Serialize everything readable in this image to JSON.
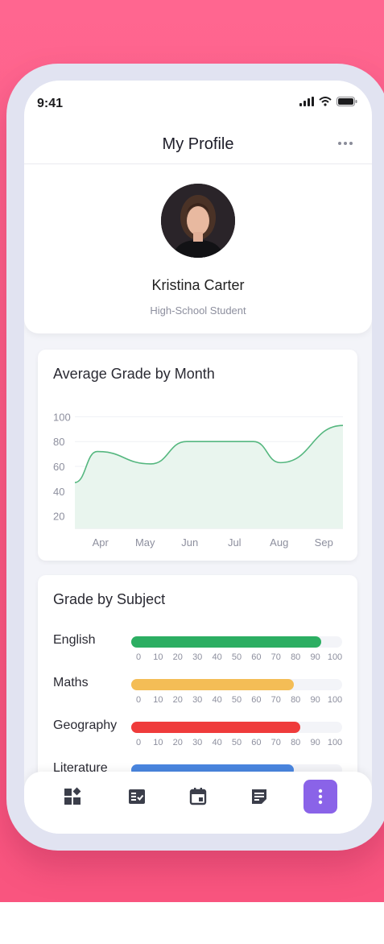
{
  "status_bar": {
    "time": "9:41"
  },
  "header": {
    "title": "My Profile",
    "more_icon": "more-horizontal-icon"
  },
  "profile": {
    "name": "Kristina Carter",
    "role": "High-School Student"
  },
  "average_chart": {
    "title": "Average Grade by Month",
    "accent_color": "#55b77f",
    "fill_color": "#e9f5ee"
  },
  "chart_data": {
    "type": "area",
    "title": "Average Grade by Month",
    "xlabel": "",
    "ylabel": "",
    "categories": [
      "Apr",
      "May",
      "Jun",
      "Jul",
      "Aug",
      "Sep"
    ],
    "y_ticks": [
      "100",
      "80",
      "60",
      "40",
      "20"
    ],
    "ylim": [
      10,
      110
    ],
    "grid": true,
    "series": [
      {
        "values": [
          {
            "x": 0,
            "y": 47
          },
          {
            "x": 0.5,
            "y": 72
          },
          {
            "x": 1.7,
            "y": 62
          },
          {
            "x": 2.5,
            "y": 80
          },
          {
            "x": 4.0,
            "y": 80
          },
          {
            "x": 4.6,
            "y": 63
          },
          {
            "x": 6.0,
            "y": 93
          }
        ]
      }
    ]
  },
  "subjects": {
    "title": "Grade by Subject",
    "scale": [
      "0",
      "10",
      "20",
      "30",
      "40",
      "50",
      "60",
      "70",
      "80",
      "90",
      "100"
    ],
    "items": [
      {
        "label": "English",
        "value": 90,
        "color": "#2cae62"
      },
      {
        "label": "Maths",
        "value": 77,
        "color": "#f4bd56"
      },
      {
        "label": "Geography",
        "value": 80,
        "color": "#ef3b3b"
      },
      {
        "label": "Literature",
        "value": 77,
        "color": "#4a86e0"
      }
    ]
  },
  "bottom_nav": {
    "items": [
      {
        "icon": "dashboard-icon",
        "active": false
      },
      {
        "icon": "checklist-icon",
        "active": false
      },
      {
        "icon": "calendar-icon",
        "active": false
      },
      {
        "icon": "notes-icon",
        "active": false
      },
      {
        "icon": "more-vertical-icon",
        "active": true
      }
    ],
    "active_color": "#8a63e8"
  }
}
